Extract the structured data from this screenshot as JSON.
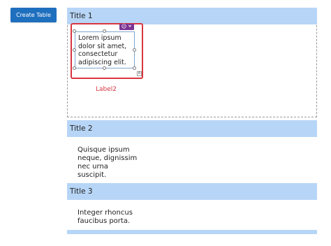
{
  "toolbar": {
    "create_table_label": "Create Table",
    "accent_color": "#1f6fbf"
  },
  "sections": [
    {
      "title": "Title 1",
      "label_control": {
        "text_lines": [
          "Lorem ipsum",
          "dolor sit amet,",
          "consectetur",
          "adipiscing elit."
        ],
        "name": "Label2",
        "selection_color": "#d9353f",
        "action_chip_color": "#7b3393",
        "action_chip_icon": "pencil-icon",
        "action_chip_caret": "chevron-down-icon",
        "resize_glyph": "A"
      }
    },
    {
      "title": "Title 2",
      "content_lines": [
        "Quisque ipsum",
        "neque, dignissim",
        "nec urna",
        "suscipit."
      ]
    },
    {
      "title": "Title 3",
      "content_lines": [
        "Integer rhoncus",
        "faucibus porta."
      ]
    }
  ],
  "title_bar_color": "#b7d5f6"
}
